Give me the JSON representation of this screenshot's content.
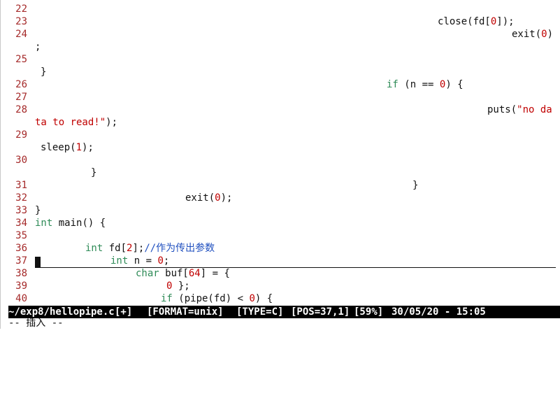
{
  "editor": {
    "lines": [
      {
        "num": "22",
        "segs": []
      },
      {
        "num": "23",
        "segs": [
          {
            "t": "close(fd[",
            "c": "code"
          },
          {
            "t": "0",
            "c": "num"
          },
          {
            "t": "]);",
            "c": "code"
          }
        ]
      },
      {
        "num": "24",
        "segs": [
          {
            "t": "exit(",
            "c": "code"
          },
          {
            "t": "0",
            "c": "num"
          },
          {
            "t": ")",
            "c": "code"
          }
        ]
      },
      {
        "num": "",
        "segs": [
          {
            "t": ";",
            "c": "code"
          }
        ]
      },
      {
        "num": "25",
        "segs": []
      },
      {
        "num": "",
        "segs": [
          {
            "t": "}",
            "c": "code"
          }
        ]
      },
      {
        "num": "26",
        "segs": [
          {
            "t": "if",
            "c": "kw"
          },
          {
            "t": " (n == ",
            "c": "code"
          },
          {
            "t": "0",
            "c": "num"
          },
          {
            "t": ") {",
            "c": "code"
          }
        ]
      },
      {
        "num": "27",
        "segs": []
      },
      {
        "num": "28",
        "segs": [
          {
            "t": "puts(",
            "c": "code"
          },
          {
            "t": "\"no da",
            "c": "str"
          }
        ]
      },
      {
        "num": "",
        "segs": [
          {
            "t": "ta to read!\"",
            "c": "str"
          },
          {
            "t": ");",
            "c": "code"
          }
        ]
      },
      {
        "num": "29",
        "segs": []
      },
      {
        "num": "",
        "segs": [
          {
            "t": "sleep(",
            "c": "code"
          },
          {
            "t": "1",
            "c": "num"
          },
          {
            "t": ");",
            "c": "code"
          }
        ]
      },
      {
        "num": "30",
        "segs": []
      },
      {
        "num": "",
        "segs": [
          {
            "t": "}",
            "c": "code"
          }
        ]
      },
      {
        "num": "31",
        "segs": [
          {
            "t": "}",
            "c": "code"
          }
        ]
      },
      {
        "num": "32",
        "segs": [
          {
            "t": "exit(",
            "c": "code"
          },
          {
            "t": "0",
            "c": "num"
          },
          {
            "t": ");",
            "c": "code"
          }
        ]
      },
      {
        "num": "33",
        "segs": [
          {
            "t": "}",
            "c": "code"
          }
        ]
      },
      {
        "num": "34",
        "segs": [
          {
            "t": "int",
            "c": "kw"
          },
          {
            "t": " main() {",
            "c": "code"
          }
        ]
      },
      {
        "num": "35",
        "segs": []
      },
      {
        "num": "36",
        "segs": [
          {
            "t": "int",
            "c": "kw"
          },
          {
            "t": " fd[",
            "c": "code"
          },
          {
            "t": "2",
            "c": "num"
          },
          {
            "t": "];",
            "c": "code"
          },
          {
            "t": "//作为传出参数",
            "c": "com"
          }
        ]
      },
      {
        "num": "37",
        "segs": [
          {
            "t": "int",
            "c": "kw"
          },
          {
            "t": " n = ",
            "c": "code"
          },
          {
            "t": "0",
            "c": "num"
          },
          {
            "t": ";",
            "c": "code"
          }
        ]
      },
      {
        "num": "38",
        "segs": [
          {
            "t": "char",
            "c": "kw"
          },
          {
            "t": " buf[",
            "c": "code"
          },
          {
            "t": "64",
            "c": "num"
          },
          {
            "t": "] = {",
            "c": "code"
          }
        ]
      },
      {
        "num": "39",
        "segs": [
          {
            "t": "0",
            "c": "num"
          },
          {
            "t": " };",
            "c": "code"
          }
        ]
      },
      {
        "num": "40",
        "segs": [
          {
            "t": "if",
            "c": "kw"
          },
          {
            "t": " (pipe(fd) < ",
            "c": "code"
          },
          {
            "t": "0",
            "c": "num"
          },
          {
            "t": ") {",
            "c": "code"
          }
        ]
      }
    ]
  },
  "status": {
    "file": "~/exp8/hellopipe.c",
    "flag": "[+]",
    "format": "[FORMAT=unix]",
    "type": "[TYPE=C]",
    "pos": "[POS=37,1]",
    "percent": "[59%]",
    "datetime": "30/05/20 - 15:05"
  },
  "mode_line": "-- 插入 --",
  "colors": {
    "line_number": "#a52a2a",
    "keyword": "#2e8b57",
    "constant": "#c00000",
    "comment": "#1f4fbf",
    "statusbar_bg": "#000000",
    "statusbar_fg": "#ffffff"
  }
}
